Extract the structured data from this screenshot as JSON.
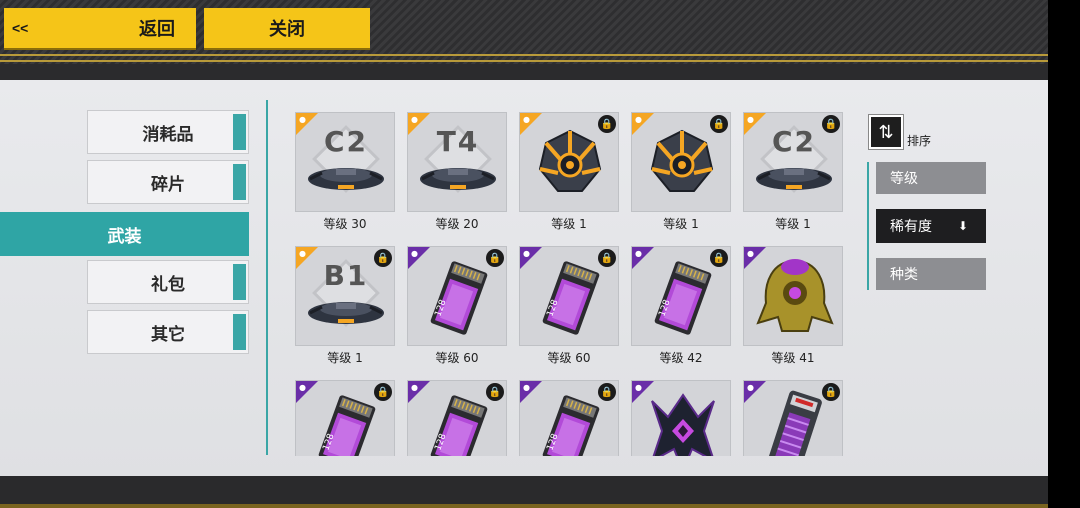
{
  "header": {
    "back_arrows": "<<",
    "back_label": "返回",
    "close_label": "关闭"
  },
  "categories": [
    {
      "label": "消耗品",
      "active": false
    },
    {
      "label": "碎片",
      "active": false
    },
    {
      "label": "武装",
      "active": true
    },
    {
      "label": "礼包",
      "active": false
    },
    {
      "label": "其它",
      "active": false
    }
  ],
  "items": [
    {
      "kind": "pad",
      "code": "C2",
      "rarity": "orange",
      "locked": false,
      "level": "等级 30"
    },
    {
      "kind": "pad",
      "code": "T4",
      "rarity": "orange",
      "locked": false,
      "level": "等级 20"
    },
    {
      "kind": "orb",
      "rarity": "orange",
      "locked": true,
      "level": "等级 1"
    },
    {
      "kind": "orb",
      "rarity": "orange",
      "locked": true,
      "level": "等级 1"
    },
    {
      "kind": "pad",
      "code": "C2",
      "rarity": "orange",
      "locked": true,
      "level": "等级 1"
    },
    {
      "kind": "pad",
      "code": "B1",
      "rarity": "orange",
      "locked": true,
      "level": "等级 1"
    },
    {
      "kind": "card",
      "card_text": "128",
      "rarity": "purple",
      "locked": true,
      "level": "等级 60"
    },
    {
      "kind": "card",
      "card_text": "128",
      "rarity": "purple",
      "locked": true,
      "level": "等级 60"
    },
    {
      "kind": "card",
      "card_text": "128",
      "rarity": "purple",
      "locked": true,
      "level": "等级 42"
    },
    {
      "kind": "helmet",
      "rarity": "purple",
      "locked": false,
      "level": "等级 41"
    },
    {
      "kind": "card",
      "card_text": "128",
      "rarity": "purple",
      "locked": true,
      "level": ""
    },
    {
      "kind": "card",
      "card_text": "128",
      "rarity": "purple",
      "locked": true,
      "level": ""
    },
    {
      "kind": "card",
      "card_text": "128",
      "rarity": "purple",
      "locked": true,
      "level": ""
    },
    {
      "kind": "crystal",
      "rarity": "purple",
      "locked": false,
      "level": ""
    },
    {
      "kind": "battery",
      "rarity": "purple",
      "locked": true,
      "level": ""
    }
  ],
  "sort": {
    "icon_glyph": "⇅",
    "label": "排序",
    "options": [
      {
        "label": "等级",
        "active": false
      },
      {
        "label": "稀有度",
        "active": true,
        "arrow": "⬇"
      },
      {
        "label": "种类",
        "active": false
      }
    ]
  },
  "icons": {
    "lock": "lock-icon",
    "person": "person-icon",
    "sort": "sort-icon"
  },
  "colors": {
    "accent_teal": "#2fa5a5",
    "button_yellow": "#f5c518",
    "rarity_orange": "#f5a623",
    "rarity_purple": "#6a2ea8"
  }
}
